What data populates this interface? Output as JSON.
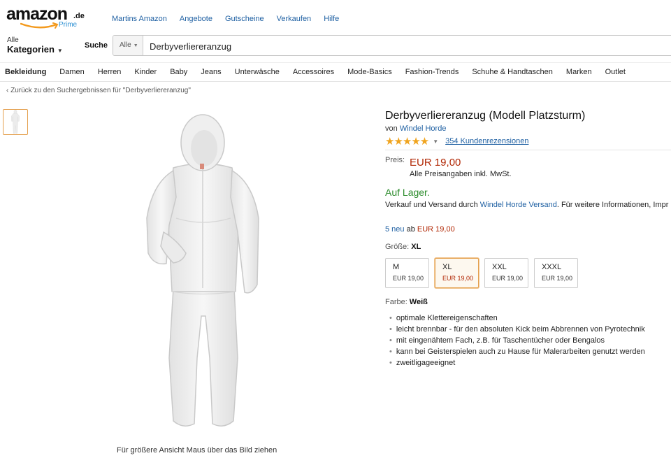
{
  "header": {
    "logo_text": "amazon",
    "logo_suffix": ".de",
    "prime_label": "Prime",
    "nav_links": [
      "Martins Amazon",
      "Angebote",
      "Gutscheine",
      "Verkaufen",
      "Hilfe"
    ]
  },
  "search": {
    "category_small": "Alle",
    "category_big": "Kategorien",
    "search_label": "Suche",
    "scope": "Alle",
    "query": "Derbyverliereranzug"
  },
  "category_nav": [
    "Bekleidung",
    "Damen",
    "Herren",
    "Kinder",
    "Baby",
    "Jeans",
    "Unterwäsche",
    "Accessoires",
    "Mode-Basics",
    "Fashion-Trends",
    "Schuhe & Handtaschen",
    "Marken",
    "Outlet"
  ],
  "breadcrumb": "‹ Zurück zu den Suchergebnissen für \"Derbyverliereranzug\"",
  "image_caption": "Für größere Ansicht Maus über das Bild ziehen",
  "product": {
    "title": "Derbyverliereranzug (Modell Platzsturm)",
    "by_prefix": "von",
    "brand": "Windel Horde",
    "stars": "★★★★★",
    "reviews": "354 Kundenrezensionen",
    "price_label": "Preis:",
    "price": "EUR 19,00",
    "price_note": "Alle Preisangaben inkl. MwSt.",
    "stock": "Auf Lager.",
    "shipping_prefix": "Verkauf und Versand durch",
    "shipping_seller": "Windel Horde Versand",
    "shipping_suffix": ". Für weitere Informationen, Impr",
    "offers_link": "5 neu",
    "offers_ab": "ab",
    "offers_price": "EUR 19,00",
    "size_label": "Größe:",
    "size_selected": "XL",
    "sizes": [
      {
        "size": "M",
        "price": "EUR 19,00"
      },
      {
        "size": "XL",
        "price": "EUR 19,00"
      },
      {
        "size": "XXL",
        "price": "EUR 19,00"
      },
      {
        "size": "XXXL",
        "price": "EUR 19,00"
      }
    ],
    "color_label": "Farbe:",
    "color_value": "Weiß",
    "bullets": [
      "optimale Klettereigenschaften",
      "leicht brennbar - für den absoluten Kick beim Abbrennen von Pyrotechnik",
      "mit eingenähtem Fach, z.B. für Taschentücher oder Bengalos",
      "kann bei Geisterspielen auch zu Hause für Malerarbeiten genutzt werden",
      "zweitligageeignet"
    ]
  },
  "colors": {
    "link": "#2061a3",
    "price": "#b12704",
    "stock": "#2d8c2d",
    "selected_border": "#e4a04e"
  }
}
